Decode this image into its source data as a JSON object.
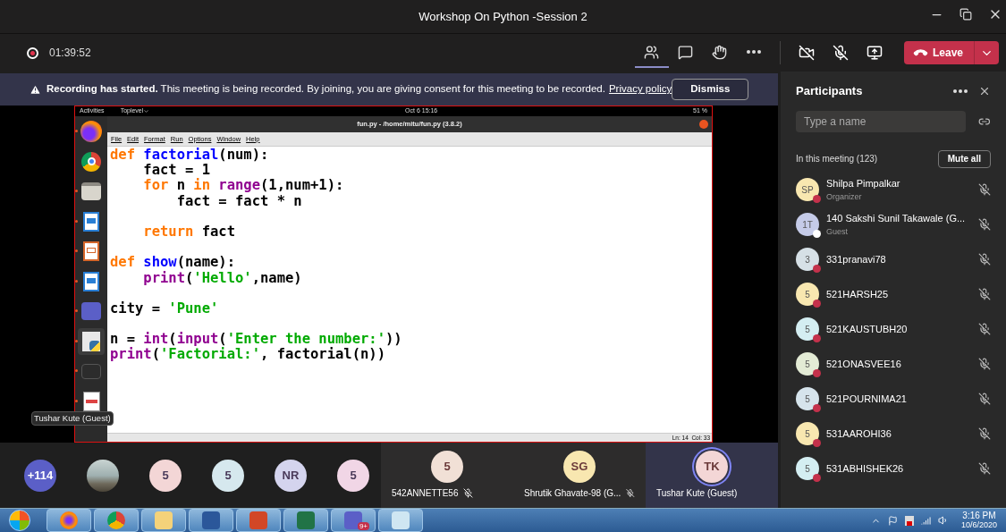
{
  "window": {
    "title": "Workshop On Python -Session 2"
  },
  "meeting_bar": {
    "recording": true,
    "timer": "01:39:52",
    "leave_label": "Leave",
    "tools": [
      {
        "kind": "participants",
        "selected": true
      },
      {
        "kind": "chat",
        "selected": false
      },
      {
        "kind": "hand",
        "selected": false
      },
      {
        "kind": "more",
        "selected": false
      }
    ],
    "camera_on": false,
    "mic_on": false
  },
  "banner": {
    "message": "**Recording has started.** This meeting is being recorded. By joining, you are giving consent for this meeting to be recorded.",
    "link": "Privacy policy",
    "button": "Dismiss"
  },
  "shared_screen": {
    "topbar": {
      "activities": "Activities",
      "app": "Toplevel",
      "clock": "Oct 6  15:16",
      "battery": "51 %"
    },
    "dock": [
      {
        "kind": "firefox",
        "running": true,
        "selected": false
      },
      {
        "kind": "chrome",
        "running": false,
        "selected": false
      },
      {
        "kind": "files",
        "running": true,
        "selected": false
      },
      {
        "kind": "writer",
        "running": true,
        "selected": false
      },
      {
        "kind": "impress",
        "running": true,
        "selected": false
      },
      {
        "kind": "writer",
        "running": true,
        "selected": false
      },
      {
        "kind": "teams",
        "running": true,
        "selected": false
      },
      {
        "kind": "idle",
        "running": true,
        "selected": true
      },
      {
        "kind": "terminal",
        "running": true,
        "selected": false
      },
      {
        "kind": "editor",
        "running": true,
        "selected": false
      }
    ],
    "editor_title": "fun.py - /home/mitu/fun.py (3.8.2)",
    "menu": [
      "File",
      "Edit",
      "Format",
      "Run",
      "Options",
      "Window",
      "Help"
    ],
    "code": [
      {
        "kind": "code",
        "tokens": [
          {
            "kind": "kw",
            "text": "def "
          },
          {
            "kind": "fn",
            "text": "factorial"
          },
          {
            "kind": "plain",
            "text": "(num):"
          }
        ]
      },
      {
        "kind": "code",
        "tokens": [
          {
            "kind": "plain",
            "text": "    fact = 1"
          }
        ]
      },
      {
        "kind": "code",
        "tokens": [
          {
            "kind": "kw",
            "text": "    for "
          },
          {
            "kind": "plain",
            "text": "n "
          },
          {
            "kind": "kw",
            "text": "in "
          },
          {
            "kind": "bi",
            "text": "range"
          },
          {
            "kind": "plain",
            "text": "(1,num+1):"
          }
        ]
      },
      {
        "kind": "code",
        "tokens": [
          {
            "kind": "plain",
            "text": "        fact = fact * n"
          }
        ]
      },
      {
        "kind": "blank"
      },
      {
        "kind": "code",
        "tokens": [
          {
            "kind": "kw",
            "text": "    return "
          },
          {
            "kind": "plain",
            "text": "fact"
          }
        ]
      },
      {
        "kind": "blank"
      },
      {
        "kind": "code",
        "tokens": [
          {
            "kind": "kw",
            "text": "def "
          },
          {
            "kind": "fn",
            "text": "show"
          },
          {
            "kind": "plain",
            "text": "(name):"
          }
        ]
      },
      {
        "kind": "code",
        "tokens": [
          {
            "kind": "bi",
            "text": "    print"
          },
          {
            "kind": "plain",
            "text": "("
          },
          {
            "kind": "str",
            "text": "'Hello'"
          },
          {
            "kind": "plain",
            "text": ",name)"
          }
        ]
      },
      {
        "kind": "blank"
      },
      {
        "kind": "code",
        "tokens": [
          {
            "kind": "plain",
            "text": "city = "
          },
          {
            "kind": "str",
            "text": "'Pune'"
          }
        ]
      },
      {
        "kind": "blank"
      },
      {
        "kind": "code",
        "tokens": [
          {
            "kind": "plain",
            "text": "n = "
          },
          {
            "kind": "bi",
            "text": "int"
          },
          {
            "kind": "plain",
            "text": "("
          },
          {
            "kind": "bi",
            "text": "input"
          },
          {
            "kind": "plain",
            "text": "("
          },
          {
            "kind": "str",
            "text": "'Enter the number:'"
          },
          {
            "kind": "plain",
            "text": "))"
          }
        ]
      },
      {
        "kind": "code",
        "tokens": [
          {
            "kind": "bi",
            "text": "print"
          },
          {
            "kind": "plain",
            "text": "("
          },
          {
            "kind": "str",
            "text": "'Factorial:'"
          },
          {
            "kind": "plain",
            "text": ", factorial(n))"
          }
        ]
      }
    ],
    "status": "Ln: 14  Col: 33",
    "presenter_tooltip": "Tushar Kute (Guest)"
  },
  "strip": [
    {
      "initials": "+114",
      "color": "#5b5fc7",
      "photo": false
    },
    {
      "photo": true
    },
    {
      "initials": "5",
      "color": "#f3d6d6",
      "photo": false
    },
    {
      "initials": "5",
      "color": "#d6e8ee",
      "photo": false
    },
    {
      "initials": "NR",
      "color": "#d4d4ee",
      "photo": false
    },
    {
      "initials": "5",
      "color": "#f1d6e6",
      "photo": false
    }
  ],
  "tiles": [
    {
      "initials": "5",
      "color": "#f1e0d6",
      "name": "542ANNETTE56",
      "muted": true,
      "speaking": false
    },
    {
      "initials": "SG",
      "color": "#f8e7b0",
      "name": "Shrutik Ghavate-98 (G...",
      "muted": true,
      "speaking": false
    },
    {
      "initials": "TK",
      "color": "#f3d6d6",
      "name": "Tushar Kute (Guest)",
      "muted": false,
      "speaking": true
    }
  ],
  "participants": {
    "title": "Participants",
    "search_placeholder": "Type a name",
    "section": "In this meeting (123)",
    "mute_all": "Mute all",
    "people": [
      {
        "avatar": {
          "initials": "SP",
          "color": "#f8e7b0"
        },
        "name": "Shilpa Pimpalkar",
        "role": "Organizer",
        "color": "#c4314b",
        "muted": true
      },
      {
        "avatar": {
          "initials": "1T",
          "color": "#c5cbe8"
        },
        "name": "140 Sakshi Sunil Takawale (G...",
        "role": "Guest",
        "color": "#ffffff",
        "muted": true
      },
      {
        "avatar": {
          "initials": "3",
          "color": "#d6e0e6"
        },
        "name": "331pranavi78",
        "color": "#c4314b",
        "muted": true
      },
      {
        "avatar": {
          "initials": "5",
          "color": "#f8e7b0"
        },
        "name": "521HARSH25",
        "color": "#c4314b",
        "muted": true
      },
      {
        "avatar": {
          "initials": "5",
          "color": "#d4eef2"
        },
        "name": "521KAUSTUBH20",
        "color": "#c4314b",
        "muted": true
      },
      {
        "avatar": {
          "initials": "5",
          "color": "#e3ebd5"
        },
        "name": "521ONASVEE16",
        "color": "#c4314b",
        "muted": true
      },
      {
        "avatar": {
          "initials": "5",
          "color": "#d6e4ec"
        },
        "name": "521POURNIMA21",
        "color": "#c4314b",
        "muted": true
      },
      {
        "avatar": {
          "initials": "5",
          "color": "#f8e7b0"
        },
        "name": "531AAROHI36",
        "color": "#c4314b",
        "muted": true
      },
      {
        "avatar": {
          "initials": "5",
          "color": "#d4eef2"
        },
        "name": "531ABHISHEK26",
        "color": "#c4314b",
        "muted": true
      }
    ]
  },
  "taskbar": {
    "apps": [
      {
        "kind": "firefox"
      },
      {
        "kind": "chrome"
      },
      {
        "kind": "explorer"
      },
      {
        "kind": "word"
      },
      {
        "kind": "powerpoint"
      },
      {
        "kind": "excel"
      },
      {
        "kind": "teams",
        "badge": "9+"
      },
      {
        "kind": "notepad"
      }
    ],
    "time": "3:16 PM",
    "date": "10/6/2020"
  }
}
